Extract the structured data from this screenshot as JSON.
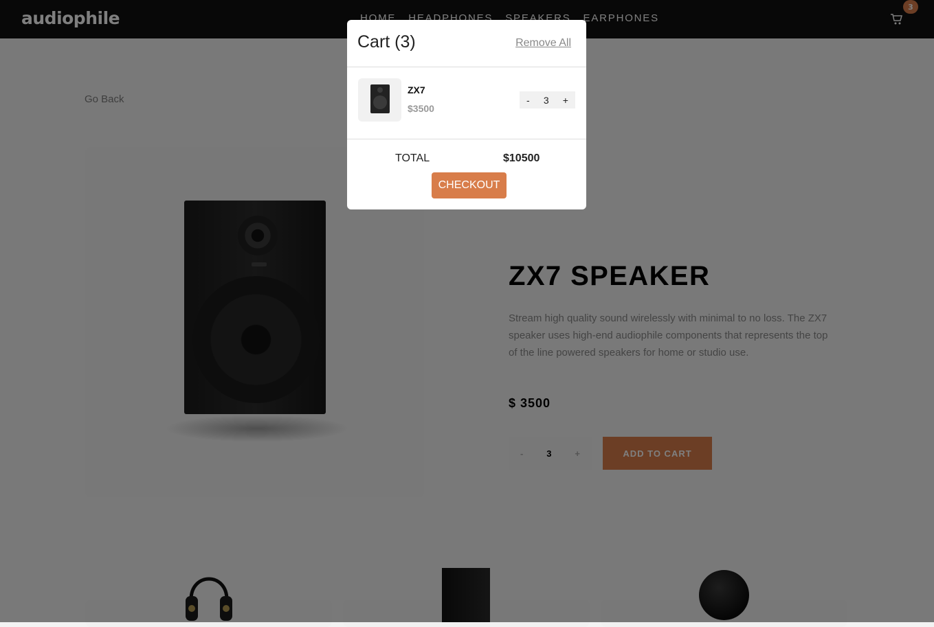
{
  "header": {
    "logo": "audiophile",
    "nav": [
      "HOME",
      "HEADPHONES",
      "SPEAKERS",
      "EARPHONES"
    ],
    "cart_icon": "cart-icon",
    "cart_count": "3"
  },
  "product": {
    "go_back": "Go Back",
    "title": "ZX7 SPEAKER",
    "description": "Stream high quality sound wirelessly with minimal to no loss. The ZX7 speaker uses high-end audiophile components that represents the top of the line powered speakers for home or studio use.",
    "price": "$ 3500",
    "quantity": {
      "minus": "-",
      "value": "3",
      "plus": "+"
    },
    "add_to_cart": "ADD TO CART"
  },
  "cart": {
    "title": "Cart (3)",
    "remove_all": "Remove All",
    "items": [
      {
        "name": "ZX7",
        "price": "$3500",
        "minus": "-",
        "quantity": "3",
        "plus": "+"
      }
    ],
    "total_label": "TOTAL",
    "total_value": "$10500",
    "checkout": "CHECKOUT"
  },
  "colors": {
    "accent": "#d87d4a",
    "nav_background": "#101010"
  }
}
